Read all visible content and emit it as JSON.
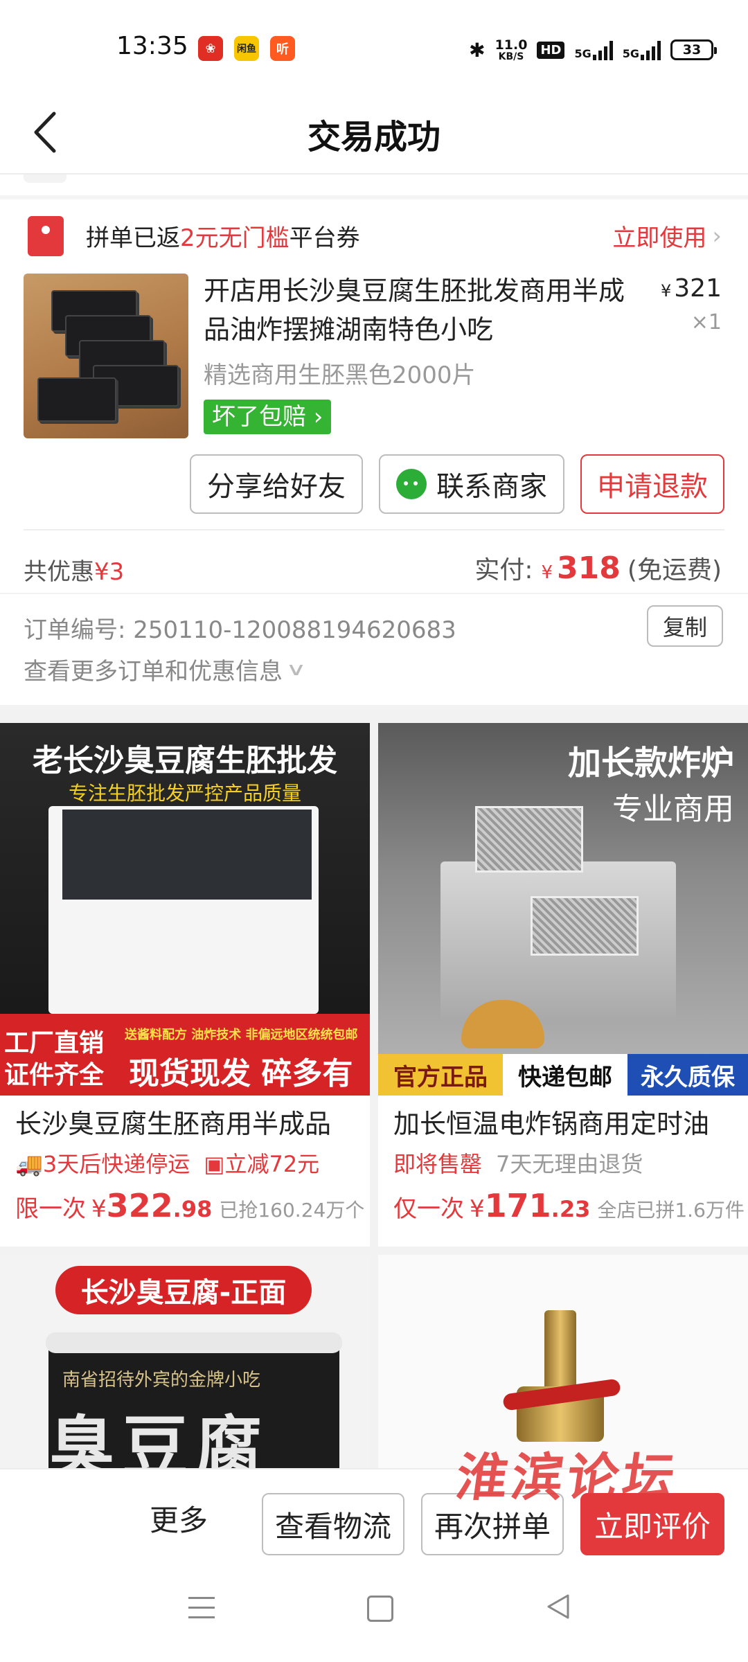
{
  "status_bar": {
    "time": "13:35",
    "apps": [
      {
        "icon": "pinduoduo-icon",
        "label": "",
        "color": "#e02e24"
      },
      {
        "icon": "xianyu-icon",
        "label": "闲鱼",
        "color": "#f7c600"
      },
      {
        "icon": "listen-icon",
        "label": "听",
        "color": "#ff5a1f"
      }
    ],
    "net_speed": "11.0",
    "net_unit": "KB/S",
    "hd": "HD",
    "sig1": "5G",
    "sig2": "5G",
    "battery": "33"
  },
  "header": {
    "title": "交易成功"
  },
  "coupon": {
    "prefix": "拼单已返",
    "highlight": "2元无门槛",
    "suffix": "平台券",
    "action": "立即使用"
  },
  "product": {
    "title": "开店用长沙臭豆腐生胚批发商用半成品油炸摆摊湖南特色小吃",
    "price_symbol": "¥",
    "price": "321",
    "qty": "×1",
    "spec": "精选商用生胚黑色2000片",
    "badge": "坏了包赔"
  },
  "actions": {
    "share": "分享给好友",
    "contact": "联系商家",
    "refund": "申请退款"
  },
  "summary": {
    "discount_label": "共优惠",
    "discount_value": "¥3",
    "paid_label": "实付:",
    "paid_symbol": "¥",
    "paid_amount": "318",
    "paid_note": "(免运费)"
  },
  "order": {
    "number_label": "订单编号:",
    "number": "250110-120088194620683",
    "copy": "复制",
    "more": "查看更多订单和优惠信息"
  },
  "recommend": [
    {
      "image_text": {
        "head": "老长沙臭豆腐生胚批发",
        "sub": "专注生胚批发严控产品质量",
        "left1": "工厂直销",
        "left2": "证件齐全",
        "right1": "送酱料配方 油炸技术 非偏远地区统统包邮",
        "right2": "现货现发 碎多有赔"
      },
      "title": "长沙臭豆腐生胚商用半成品",
      "tags": [
        "3天后快递停运",
        "立减72元"
      ],
      "price_prefix": "限一次",
      "price_symbol": "¥",
      "price_int": "322",
      "price_dec": ".98",
      "sold": "已抢160.24万个"
    },
    {
      "image_text": {
        "head": "加长款炸炉",
        "sub": "专业商用",
        "strip": [
          "官方正品",
          "快递包邮",
          "永久质保"
        ]
      },
      "title": "加长恒温电炸锅商用定时油",
      "tags": [
        "即将售罄",
        "7天无理由退货"
      ],
      "price_prefix": "仅一次",
      "price_symbol": "¥",
      "price_int": "171",
      "price_dec": ".23",
      "sold": "全店已拼1.6万件"
    },
    {
      "image_text": {
        "pill": "长沙臭豆腐-正面",
        "cup_small": "南省招待外宾的金牌小吃",
        "cup_big": "臭豆腐"
      }
    },
    {
      "image_text": {}
    }
  ],
  "bottom_bar": {
    "more": "更多",
    "logistics": "查看物流",
    "rebuy": "再次拼单",
    "review": "立即评价"
  },
  "watermark": "淮滨论坛",
  "colors": {
    "accent": "#e4393c",
    "green_badge": "#35b333",
    "wechat": "#2bad38"
  }
}
